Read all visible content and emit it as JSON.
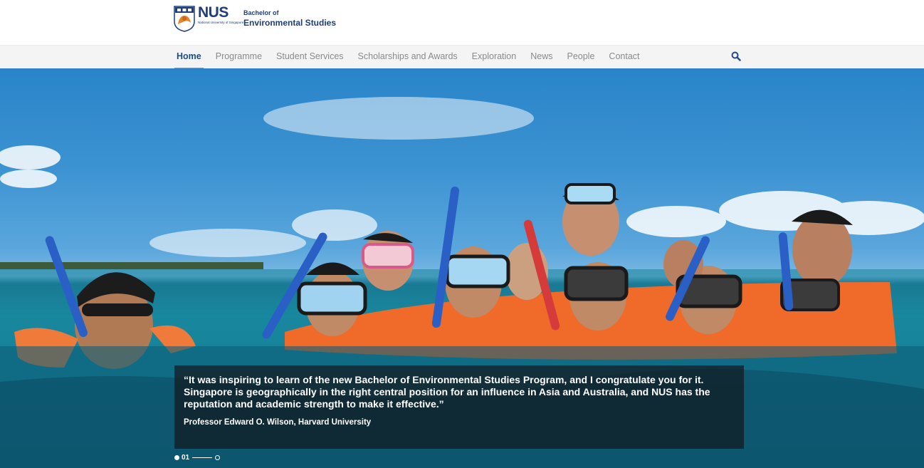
{
  "brand": {
    "logo_text": "NUS",
    "logo_subtext": "National University of Singapore",
    "program_line1": "Bachelor of",
    "program_line2": "Environmental Studies"
  },
  "nav": {
    "items": [
      {
        "label": "Home",
        "active": true
      },
      {
        "label": "Programme"
      },
      {
        "label": "Student Services"
      },
      {
        "label": "Scholarships and Awards"
      },
      {
        "label": "Exploration"
      },
      {
        "label": "News"
      },
      {
        "label": "People"
      },
      {
        "label": "Contact"
      }
    ],
    "search_icon": "search-icon"
  },
  "hero": {
    "image_subject": "students snorkeling in the sea",
    "quote": "“It was inspiring to learn of the new Bachelor of Environmental Studies Program, and I congratulate you for it. Singapore is geographically in the right central position for an influence in Asia and Australia, and NUS has the reputation and academic strength to make it effective.”",
    "author": "Professor Edward O. Wilson, Harvard University",
    "pager_current": "01"
  },
  "colors": {
    "brand_blue": "#1f3d7a",
    "accent_orange": "#e8832b",
    "nav_bg": "#f4f4f4"
  }
}
